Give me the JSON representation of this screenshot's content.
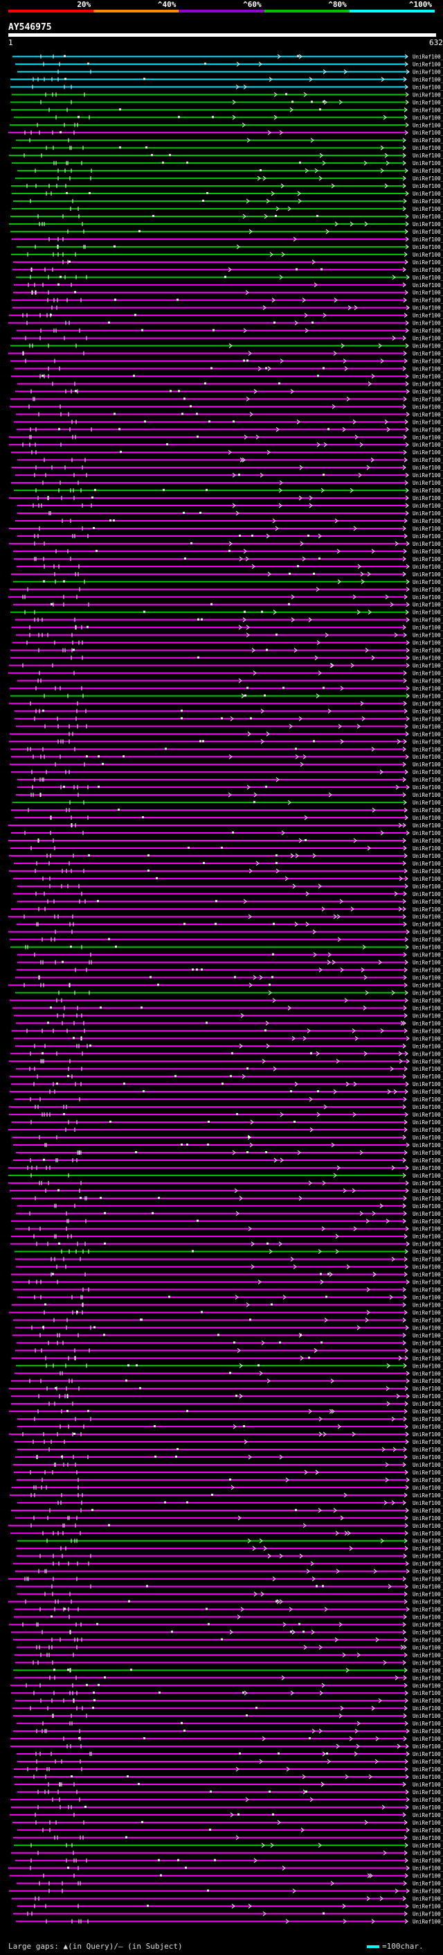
{
  "query": {
    "name": "AY546975",
    "start": "1",
    "end": "632"
  },
  "scale": {
    "labels": [
      "20%",
      "^40%",
      "^60%",
      "^80%",
      "^100%"
    ],
    "segments": [
      {
        "color": "#ff0000"
      },
      {
        "color": "#ff8c00"
      },
      {
        "color": "#9400d3"
      },
      {
        "color": "#00c000"
      },
      {
        "color": "#00ffff"
      }
    ]
  },
  "legend": {
    "gaps_text": "Large gaps: ▲(in Query)/— (in Subject)",
    "scale_text": "=100char."
  },
  "colors": {
    "cyan": "#00e6ff",
    "green": "#00c800",
    "magenta": "#ff00ff",
    "pink": "#ff55ff"
  },
  "hits": [
    {
      "name": "UniRef100_C0LGS2",
      "class": "cyan"
    },
    {
      "name": "UniRef100_B9MFJ2",
      "class": "cyan"
    },
    {
      "name": "UniRef100_B9S2U5",
      "class": "cyan"
    },
    {
      "name": "UniRef100_A7QE13",
      "class": "cyan"
    },
    {
      "name": "UniRef100_A7NT13",
      "class": "cyan"
    },
    {
      "name": "UniRef100_B9HHJ1",
      "class": "green"
    },
    {
      "name": "UniRef100_B9R841",
      "class": "green"
    },
    {
      "name": "UniRef100_A5AE51",
      "class": "green"
    },
    {
      "name": "UniRef100_Q01KJ6",
      "class": "green"
    },
    {
      "name": "UniRef100_B9FC38",
      "class": "green"
    },
    {
      "name": "UniRef100_C6FF70",
      "class": "magenta"
    },
    {
      "name": "UniRef100_C5YEF7",
      "class": "green"
    },
    {
      "name": "UniRef100_Q9LRO4",
      "class": "green"
    },
    {
      "name": "UniRef100_Q7YUH4",
      "class": "green"
    },
    {
      "name": "UniRef100_B9I7B5",
      "class": "green"
    },
    {
      "name": "UniRef100_B9F6F8",
      "class": "green"
    },
    {
      "name": "UniRef100_A7RSH6",
      "class": "green"
    },
    {
      "name": "UniRef100_B9T5K9",
      "class": "green"
    },
    {
      "name": "UniRef100_C5YFS0",
      "class": "green"
    },
    {
      "name": "UniRef100_Q2R2D7",
      "class": "green"
    },
    {
      "name": "UniRef100_B9HHM1",
      "class": "green"
    },
    {
      "name": "UniRef100_B9NFD3",
      "class": "green"
    },
    {
      "name": "UniRef100_B8AHK3",
      "class": "green"
    },
    {
      "name": "UniRef100_B9RHK7",
      "class": "green"
    },
    {
      "name": "UniRef100_B9SJE5",
      "class": "magenta"
    },
    {
      "name": "UniRef100_B9SNB4",
      "class": "green"
    },
    {
      "name": "UniRef100_B9EYY2",
      "class": "green"
    },
    {
      "name": "UniRef100_A2WQJ5",
      "class": "magenta"
    },
    {
      "name": "UniRef100_A7PJJ5",
      "class": "magenta"
    },
    {
      "name": "UniRef100_C7J8B6",
      "class": "green"
    },
    {
      "name": "UniRef100_C5Z5E9",
      "class": "magenta"
    },
    {
      "name": "UniRef100_A7P5W5",
      "class": "magenta"
    },
    {
      "name": "UniRef100_A7QEW6",
      "class": "magenta"
    },
    {
      "name": "UniRef100_B9I6I0",
      "class": "magenta"
    },
    {
      "name": "UniRef100_Q2QQZ9",
      "class": "magenta"
    },
    {
      "name": "UniRef100_C7J8G3",
      "class": "magenta"
    },
    {
      "name": "UniRef100_A5AIA2",
      "class": "magenta"
    },
    {
      "name": "UniRef100_A2ZFH5",
      "class": "magenta"
    },
    {
      "name": "UniRef100_B8AKS3",
      "class": "green"
    },
    {
      "name": "UniRef100_A7PSK5",
      "class": "magenta"
    },
    {
      "name": "UniRef100_A7PSA2",
      "class": "magenta"
    },
    {
      "name": "UniRef100_UPI000...",
      "class": "magenta"
    },
    {
      "name": "UniRef100_Q53P88",
      "class": "magenta"
    },
    {
      "name": "UniRef100_Q1HYD0",
      "class": "magenta"
    },
    {
      "name": "UniRef100_C7J891",
      "class": "magenta"
    },
    {
      "name": "UniRef100_A3AHJ1",
      "class": "magenta"
    },
    {
      "name": "UniRef100_A2XFM5",
      "class": "magenta"
    },
    {
      "name": "UniRef100_Q0J5T2",
      "class": "magenta"
    },
    {
      "name": "UniRef100_B9MHX5",
      "class": "magenta"
    },
    {
      "name": "UniRef100_Q4G2V6",
      "class": "magenta"
    },
    {
      "name": "UniRef100_Q4G2V2",
      "class": "magenta"
    },
    {
      "name": "UniRef100_Q4G2V9",
      "class": "magenta"
    },
    {
      "name": "UniRef100_Q4G2U7",
      "class": "magenta"
    },
    {
      "name": "UniRef100_Q4G2U6",
      "class": "magenta"
    },
    {
      "name": "UniRef100_Q4G2U5",
      "class": "magenta"
    },
    {
      "name": "UniRef100_B8LQ26",
      "class": "magenta"
    },
    {
      "name": "UniRef100_A2Z3J6",
      "class": "magenta"
    },
    {
      "name": "UniRef100_UPI000...",
      "class": "green"
    },
    {
      "name": "UniRef100_Q0JQL4",
      "class": "magenta"
    },
    {
      "name": "UniRef100_B9SL14",
      "class": "magenta"
    },
    {
      "name": "UniRef100_B9HIH1",
      "class": "magenta"
    },
    {
      "name": "UniRef100_A7QQL8",
      "class": "magenta"
    },
    {
      "name": "UniRef100_A5B516",
      "class": "magenta"
    },
    {
      "name": "UniRef100_Q53PD6",
      "class": "magenta"
    },
    {
      "name": "UniRef100_Q0IU97",
      "class": "magenta"
    },
    {
      "name": "UniRef100_C7J8B2",
      "class": "magenta"
    },
    {
      "name": "UniRef100_A2XR00",
      "class": "magenta"
    },
    {
      "name": "UniRef100_A5FMD2",
      "class": "magenta"
    },
    {
      "name": "UniRef100_C5XVD6",
      "class": "magenta"
    },
    {
      "name": "UniRef100_C5XH67",
      "class": "green"
    },
    {
      "name": "UniRef100_C0F326",
      "class": "magenta"
    },
    {
      "name": "UniRef100_Q4G2V1",
      "class": "magenta"
    },
    {
      "name": "UniRef100_Q2QN21",
      "class": "magenta"
    },
    {
      "name": "UniRef100_C5Y3B4",
      "class": "green"
    },
    {
      "name": "UniRef100_B9SNB2",
      "class": "magenta"
    },
    {
      "name": "UniRef100_Q53PD2",
      "class": "magenta"
    },
    {
      "name": "UniRef100_Q53PC9",
      "class": "magenta"
    },
    {
      "name": "UniRef100_Q0IU96",
      "class": "magenta"
    },
    {
      "name": "UniRef100_B9SLM0",
      "class": "magenta"
    },
    {
      "name": "UniRef100_A2YLK8",
      "class": "magenta"
    },
    {
      "name": "UniRef100_UPI000...",
      "class": "magenta"
    },
    {
      "name": "UniRef100_Q2R2K3",
      "class": "magenta"
    },
    {
      "name": "UniRef100_A7QHK8",
      "class": "magenta"
    },
    {
      "name": "UniRef100_A7P5H5",
      "class": "magenta"
    },
    {
      "name": "UniRef100_Q9LHP4",
      "class": "green"
    },
    {
      "name": "UniRef100_A7RS10",
      "class": "magenta"
    },
    {
      "name": "UniRef100_Q4G2W2",
      "class": "magenta"
    },
    {
      "name": "UniRef100_Q4G398",
      "class": "magenta"
    },
    {
      "name": "UniRef100_Q4G2Y5",
      "class": "magenta"
    },
    {
      "name": "UniRef100_Q2R2D3",
      "class": "magenta"
    },
    {
      "name": "UniRef100_C5YFC0",
      "class": "magenta"
    },
    {
      "name": "UniRef100_B9SNB7",
      "class": "magenta"
    },
    {
      "name": "UniRef100_B8BL50",
      "class": "magenta"
    },
    {
      "name": "UniRef100_B8BG60",
      "class": "magenta"
    },
    {
      "name": "UniRef100_A2YEG3",
      "class": "magenta"
    },
    {
      "name": "UniRef100_Q6ZVD9",
      "class": "magenta"
    },
    {
      "name": "UniRef100_C6ZED4",
      "class": "magenta"
    },
    {
      "name": "UniRef100_C5YFE7",
      "class": "magenta"
    },
    {
      "name": "UniRef100_B9RAZ4",
      "class": "green"
    },
    {
      "name": "UniRef100_A2WXP6",
      "class": "magenta"
    },
    {
      "name": "UniRef100_UPI000...",
      "class": "magenta"
    },
    {
      "name": "UniRef100_Q6YUZ6",
      "class": "magenta"
    },
    {
      "name": "UniRef100_B8AFR8",
      "class": "magenta"
    },
    {
      "name": "UniRef100_Q4G2V4",
      "class": "magenta"
    },
    {
      "name": "UniRef100_B9S685",
      "class": "magenta"
    },
    {
      "name": "UniRef100_B9HLH8",
      "class": "magenta"
    },
    {
      "name": "UniRef100_A7Q3Q3",
      "class": "magenta"
    },
    {
      "name": "UniRef100_A7PJJ1",
      "class": "magenta"
    },
    {
      "name": "UniRef100_A3A4J6",
      "class": "magenta"
    },
    {
      "name": "UniRef100_Q6H845",
      "class": "magenta"
    },
    {
      "name": "UniRef100_Q4G2V9",
      "class": "magenta"
    },
    {
      "name": "UniRef100_Q4G2V7",
      "class": "magenta"
    },
    {
      "name": "UniRef100_Q4G2V3",
      "class": "magenta"
    },
    {
      "name": "UniRef100_Q2R435",
      "class": "magenta"
    },
    {
      "name": "UniRef100_B9SL50",
      "class": "magenta"
    },
    {
      "name": "UniRef100_B9FI95",
      "class": "magenta"
    },
    {
      "name": "UniRef100_B8BL29",
      "class": "magenta"
    },
    {
      "name": "UniRef100_UPI000...",
      "class": "green"
    },
    {
      "name": "UniRef100_Q9LJS5",
      "class": "magenta"
    },
    {
      "name": "UniRef100_Q3E440",
      "class": "magenta"
    },
    {
      "name": "UniRef100_Q53ND6",
      "class": "magenta"
    },
    {
      "name": "UniRef100_Q0IRA3",
      "class": "magenta"
    },
    {
      "name": "UniRef100_B9ND75",
      "class": "magenta"
    },
    {
      "name": "UniRef100_B9RF52",
      "class": "green"
    },
    {
      "name": "UniRef100_B9HD76",
      "class": "magenta"
    },
    {
      "name": "UniRef100_A7PF30",
      "class": "magenta"
    },
    {
      "name": "UniRef100_Q53Q93",
      "class": "magenta"
    },
    {
      "name": "UniRef100_Q5VQK7",
      "class": "magenta"
    },
    {
      "name": "UniRef100_Q2R2J4",
      "class": "magenta"
    },
    {
      "name": "UniRef100_Q53QC5",
      "class": "magenta"
    },
    {
      "name": "UniRef100_B8AFT2",
      "class": "magenta"
    },
    {
      "name": "UniRef100_A2ZBY8",
      "class": "magenta"
    },
    {
      "name": "UniRef100_A2WL60",
      "class": "magenta"
    },
    {
      "name": "UniRef100_Q9LY03",
      "class": "magenta"
    },
    {
      "name": "UniRef100_Q8VYT7",
      "class": "magenta"
    },
    {
      "name": "UniRef100_B9N9G9",
      "class": "magenta"
    },
    {
      "name": "UniRef100_B8LLC9",
      "class": "magenta"
    },
    {
      "name": "UniRef100_A7QDL9",
      "class": "magenta"
    },
    {
      "name": "UniRef100_A2Z647",
      "class": "magenta"
    },
    {
      "name": "UniRef100_UPI000...",
      "class": "magenta"
    },
    {
      "name": "UniRef100_A7QFF3",
      "class": "magenta"
    },
    {
      "name": "UniRef100_Q8LKV9",
      "class": "magenta"
    },
    {
      "name": "UniRef100_Q5VPA8",
      "class": "magenta"
    },
    {
      "name": "UniRef100_Q1RS30",
      "class": "magenta"
    },
    {
      "name": "UniRef100_C5XJD0",
      "class": "magenta"
    },
    {
      "name": "UniRef100_C5XQ04",
      "class": "magenta"
    },
    {
      "name": "UniRef100_C5Y0Y7",
      "class": "magenta"
    },
    {
      "name": "UniRef100_B9HFC7",
      "class": "green"
    },
    {
      "name": "UniRef100_B9A7H7",
      "class": "magenta"
    },
    {
      "name": "UniRef100_A5CI72",
      "class": "magenta"
    },
    {
      "name": "UniRef100_UPI000...",
      "class": "magenta"
    },
    {
      "name": "UniRef100_Q7XFM6",
      "class": "magenta"
    },
    {
      "name": "UniRef100_Q0J5E7",
      "class": "magenta"
    },
    {
      "name": "UniRef100_B8AFS0",
      "class": "magenta"
    },
    {
      "name": "UniRef100_B9G830",
      "class": "magenta"
    },
    {
      "name": "UniRef100_A7QKS1",
      "class": "magenta"
    },
    {
      "name": "UniRef100_A5BQQ4",
      "class": "magenta"
    },
    {
      "name": "UniRef100_Q6F1Z3",
      "class": "green"
    },
    {
      "name": "UniRef100_UPI000...",
      "class": "magenta"
    },
    {
      "name": "UniRef100_UPI000...",
      "class": "magenta"
    },
    {
      "name": "UniRef100_C0PTN1",
      "class": "magenta"
    },
    {
      "name": "UniRef100_B9HLS0",
      "class": "magenta"
    },
    {
      "name": "UniRef100_B8BL48",
      "class": "magenta"
    },
    {
      "name": "UniRef100_A9CGP3",
      "class": "magenta"
    },
    {
      "name": "UniRef100_A7PVL7",
      "class": "magenta"
    },
    {
      "name": "UniRef100_Q9SPL7",
      "class": "magenta"
    },
    {
      "name": "UniRef100_Q0C9M5",
      "class": "magenta"
    },
    {
      "name": "UniRef100_Q2S0E4",
      "class": "magenta"
    },
    {
      "name": "UniRef100_A5A8M2",
      "class": "magenta"
    },
    {
      "name": "UniRef100_B9T4Y2",
      "class": "magenta"
    },
    {
      "name": "UniRef100_B9HHU2",
      "class": "magenta"
    },
    {
      "name": "UniRef100_B9N9G7",
      "class": "magenta"
    },
    {
      "name": "UniRef100_B9NE74",
      "class": "green"
    },
    {
      "name": "UniRef100_A3CDD5",
      "class": "magenta"
    },
    {
      "name": "UniRef100_UPI000...",
      "class": "magenta"
    },
    {
      "name": "UniRef100_UPI000...",
      "class": "magenta"
    },
    {
      "name": "UniRef100_Q53PE9",
      "class": "magenta"
    },
    {
      "name": "UniRef100_Q53PD0",
      "class": "magenta"
    },
    {
      "name": "UniRef100_Q0QZE0",
      "class": "magenta"
    },
    {
      "name": "UniRef100_C5YZP1",
      "class": "magenta"
    },
    {
      "name": "UniRef100_B9SLK8",
      "class": "magenta"
    },
    {
      "name": "UniRef100_B8AG14",
      "class": "magenta"
    },
    {
      "name": "UniRef100_B9FTY0",
      "class": "magenta"
    },
    {
      "name": "UniRef100_A7PYR9",
      "class": "magenta"
    },
    {
      "name": "UniRef100_A3AGK9",
      "class": "magenta"
    },
    {
      "name": "UniRef100_Q6ETI7",
      "class": "magenta"
    },
    {
      "name": "UniRef100_Q6VK87",
      "class": "magenta"
    },
    {
      "name": "UniRef100_B9NFF9",
      "class": "magenta"
    },
    {
      "name": "UniRef100_B9IHP6",
      "class": "magenta"
    },
    {
      "name": "UniRef100_B9I4Q3",
      "class": "magenta"
    },
    {
      "name": "UniRef100_B9HE20",
      "class": "magenta"
    },
    {
      "name": "UniRef100_B9NFJ2",
      "class": "magenta"
    },
    {
      "name": "UniRef100_B9F1R3",
      "class": "magenta"
    },
    {
      "name": "UniRef100_B9EA74",
      "class": "magenta"
    },
    {
      "name": "UniRef100_B8B443",
      "class": "magenta"
    },
    {
      "name": "UniRef100_A6YAF2",
      "class": "green"
    },
    {
      "name": "UniRef100_A9SMZ6",
      "class": "magenta"
    },
    {
      "name": "UniRef100_A5BMV7",
      "class": "magenta"
    },
    {
      "name": "UniRef100_UPI000...",
      "class": "magenta"
    },
    {
      "name": "UniRef100_Q8VX13",
      "class": "magenta"
    },
    {
      "name": "UniRef100_Q6H8C5",
      "class": "magenta"
    },
    {
      "name": "UniRef100_Q69KC6",
      "class": "magenta"
    },
    {
      "name": "UniRef100_Q5ZS53",
      "class": "magenta"
    },
    {
      "name": "UniRef100_Q4G2W1",
      "class": "magenta"
    },
    {
      "name": "UniRef100_Q4G2W0",
      "class": "magenta"
    },
    {
      "name": "UniRef100_C5YNG1",
      "class": "magenta"
    },
    {
      "name": "UniRef100_B9SLK4",
      "class": "magenta"
    },
    {
      "name": "UniRef100_B9RMH3",
      "class": "magenta"
    },
    {
      "name": "UniRef100_B9HQ29",
      "class": "magenta"
    },
    {
      "name": "UniRef100_B9H2B1",
      "class": "magenta"
    },
    {
      "name": "UniRef100_B9FMP7",
      "class": "magenta"
    },
    {
      "name": "UniRef100_Q6V0X3",
      "class": "magenta"
    },
    {
      "name": "UniRef100_B9HE37",
      "class": "green"
    },
    {
      "name": "UniRef100_B9HA88",
      "class": "magenta"
    },
    {
      "name": "UniRef100_A7QHV4",
      "class": "magenta"
    },
    {
      "name": "UniRef100_A2WYU4",
      "class": "magenta"
    },
    {
      "name": "UniRef100_A2X730",
      "class": "magenta"
    },
    {
      "name": "UniRef100_UPI000...",
      "class": "magenta"
    },
    {
      "name": "UniRef100_Q9ZTJ9",
      "class": "magenta"
    },
    {
      "name": "UniRef100_Q9ZTJ8",
      "class": "magenta"
    },
    {
      "name": "UniRef100_Q0J9R8",
      "class": "magenta"
    },
    {
      "name": "UniRef100_Q0JD99",
      "class": "magenta"
    },
    {
      "name": "UniRef100_B9S9F9",
      "class": "magenta"
    },
    {
      "name": "UniRef100_B9SQ07",
      "class": "magenta"
    },
    {
      "name": "UniRef100_A9VR35",
      "class": "magenta"
    },
    {
      "name": "UniRef100_A6N114",
      "class": "magenta"
    },
    {
      "name": "UniRef100_A2XLK0",
      "class": "magenta"
    },
    {
      "name": "UniRef100_A2X2F1",
      "class": "magenta"
    },
    {
      "name": "UniRef100_UPI000...",
      "class": "magenta"
    },
    {
      "name": "UniRef100_UPI000...",
      "class": "magenta"
    },
    {
      "name": "UniRef100_Q69P18",
      "class": "magenta"
    },
    {
      "name": "UniRef100_Q53QA7",
      "class": "magenta"
    },
    {
      "name": "UniRef100_Q0JEL5",
      "class": "magenta"
    },
    {
      "name": "UniRef100_C5Z137",
      "class": "magenta"
    },
    {
      "name": "UniRef100_B9NC47",
      "class": "magenta"
    },
    {
      "name": "UniRef100_B9HEU6",
      "class": "green"
    },
    {
      "name": "UniRef100_B9NL52",
      "class": "magenta"
    },
    {
      "name": "UniRef100_B9HSL2",
      "class": "magenta"
    },
    {
      "name": "UniRef100_B8BFH2",
      "class": "magenta"
    },
    {
      "name": "UniRef100_A9RSR3",
      "class": "magenta"
    },
    {
      "name": "UniRef100_A7VR28",
      "class": "magenta"
    },
    {
      "name": "UniRef100_A7VRE2",
      "class": "magenta"
    },
    {
      "name": "UniRef100_A7Q1M8",
      "class": "magenta"
    },
    {
      "name": "UniRef100_A7PHX2",
      "class": "magenta"
    },
    {
      "name": "UniRef100_A3CC06",
      "class": "magenta"
    },
    {
      "name": "UniRef100_A2Z1W8",
      "class": "magenta"
    }
  ]
}
